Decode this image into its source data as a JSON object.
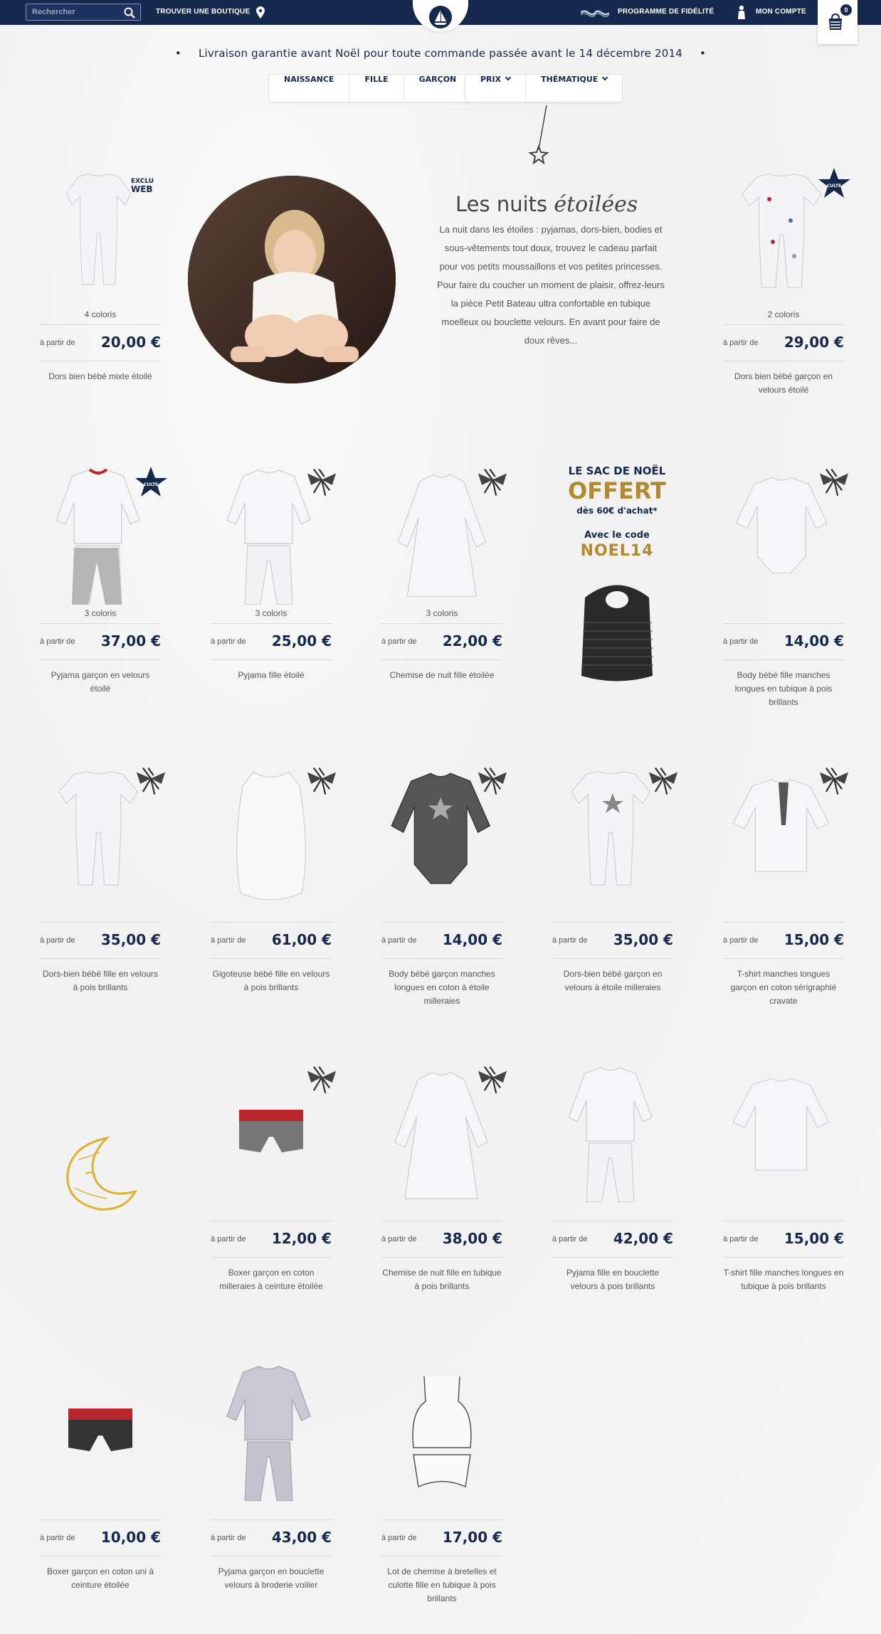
{
  "header": {
    "search_placeholder": "Rechercher",
    "store_finder": "TROUVER UNE BOUTIQUE",
    "loyalty": "PROGRAMME DE FIDÉLITÉ",
    "account": "MON COMPTE",
    "cart_count": "0"
  },
  "promo": {
    "text": "Livraison garantie avant Noël pour toute commande passée avant le 14 décembre 2014",
    "bullet": "•"
  },
  "nav": {
    "categories": [
      "NAISSANCE",
      "FILLE",
      "GARÇON"
    ],
    "filters": [
      "PRIX",
      "THÉMATIQUE"
    ]
  },
  "hero": {
    "title": "Les nuits",
    "title_script": "étoilées",
    "text": "La nuit dans les étoiles : pyjamas, dors-bien, bodies et sous-vêtements tout doux, trouvez le cadeau parfait pour vos petits moussaillons et vos petites princesses. Pour faire du coucher un moment de plaisir, offrez-leurs la pièce Petit Bateau ultra confortable en tubique moelleux ou bouclette velours. En avant pour faire de doux rêves..."
  },
  "badges": {
    "exclu": "EXCLU",
    "web": "WEB",
    "culte": "CULTE"
  },
  "from_label": "à partir de",
  "products": [
    {
      "colors": "4 coloris",
      "price": "20,00 €",
      "name": "Dors bien bébé mixte étoilé"
    },
    {
      "colors": "2 coloris",
      "price": "29,00 €",
      "name": "Dors bien bébé garçon en velours étoilé"
    },
    {
      "colors": "3 coloris",
      "price": "37,00 €",
      "name": "Pyjama garçon en velours étoilé"
    },
    {
      "colors": "3 coloris",
      "price": "25,00 €",
      "name": "Pyjama fille étoilé"
    },
    {
      "colors": "3 coloris",
      "price": "22,00 €",
      "name": "Chemise de nuit fille étoilée"
    },
    {
      "colors": "",
      "price": "14,00 €",
      "name": "Body bébé fille manches longues en tubique à pois brillants"
    },
    {
      "colors": "",
      "price": "35,00 €",
      "name": "Dors-bien bébé fille en velours à pois brillants"
    },
    {
      "colors": "",
      "price": "61,00 €",
      "name": "Gigoteuse bébé fille en velours à pois brillants"
    },
    {
      "colors": "",
      "price": "14,00 €",
      "name": "Body bébé garçon manches longues en coton à étoile milleraies"
    },
    {
      "colors": "",
      "price": "35,00 €",
      "name": "Dors-bien bébé garçon en velours à étoile milleraies"
    },
    {
      "colors": "",
      "price": "15,00 €",
      "name": "T-shirt manches longues garçon en coton sérigraphié cravate"
    },
    {
      "colors": "",
      "price": "12,00 €",
      "name": "Boxer garçon en coton milleraies à ceinture étoilée"
    },
    {
      "colors": "",
      "price": "38,00 €",
      "name": "Chemise de nuit fille en tubique à pois brillants"
    },
    {
      "colors": "",
      "price": "42,00 €",
      "name": "Pyjama fille en bouclette velours à pois brillants"
    },
    {
      "colors": "",
      "price": "15,00 €",
      "name": "T-shirt fille manches longues en tubique à pois brillants"
    },
    {
      "colors": "",
      "price": "10,00 €",
      "name": "Boxer garçon en coton uni à ceinture étoilée"
    },
    {
      "colors": "",
      "price": "43,00 €",
      "name": "Pyjama garçon en bouclette velours à broderie voilier"
    },
    {
      "colors": "",
      "price": "17,00 €",
      "name": "Lot de chemise à bretelles et culotte fille en tubique à pois brillants"
    }
  ],
  "gift": {
    "line1": "LE SAC DE NOËL",
    "line2": "OFFERT",
    "line3": "dès 60€ d'achat*",
    "line4": "Avec le code",
    "line5": "NOEL14"
  },
  "colors": {
    "navy": "#15294f",
    "gold": "#b28a30",
    "red": "#c0262d"
  }
}
